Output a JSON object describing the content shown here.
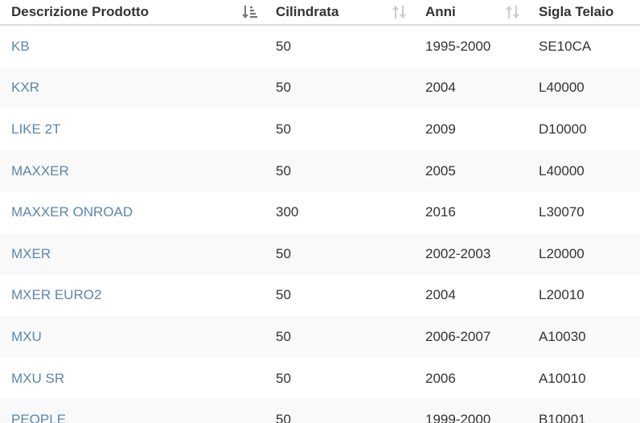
{
  "table": {
    "headers": [
      {
        "label": "Descrizione Prodotto",
        "sort": "active-desc"
      },
      {
        "label": "Cilindrata",
        "sort": "inactive"
      },
      {
        "label": "Anni",
        "sort": "inactive"
      },
      {
        "label": "Sigla Telaio",
        "sort": "none"
      }
    ],
    "rows": [
      {
        "desc": "KB",
        "cilindrata": "50",
        "anni": "1995-2000",
        "sigla": "SE10CA"
      },
      {
        "desc": "KXR",
        "cilindrata": "50",
        "anni": "2004",
        "sigla": "L40000"
      },
      {
        "desc": "LIKE 2T",
        "cilindrata": "50",
        "anni": "2009",
        "sigla": "D10000"
      },
      {
        "desc": "MAXXER",
        "cilindrata": "50",
        "anni": "2005",
        "sigla": "L40000"
      },
      {
        "desc": "MAXXER ONROAD",
        "cilindrata": "300",
        "anni": "2016",
        "sigla": "L30070"
      },
      {
        "desc": "MXER",
        "cilindrata": "50",
        "anni": "2002-2003",
        "sigla": "L20000"
      },
      {
        "desc": "MXER EURO2",
        "cilindrata": "50",
        "anni": "2004",
        "sigla": "L20010"
      },
      {
        "desc": "MXU",
        "cilindrata": "50",
        "anni": "2006-2007",
        "sigla": "A10030"
      },
      {
        "desc": "MXU SR",
        "cilindrata": "50",
        "anni": "2006",
        "sigla": "A10010"
      },
      {
        "desc": "PEOPLE",
        "cilindrata": "50",
        "anni": "1999-2000",
        "sigla": "B10001"
      }
    ]
  },
  "colors": {
    "link": "#5a87ad",
    "text": "#333333",
    "stripe": "#f9f9f9",
    "sort_active": "#777777",
    "sort_inactive": "#cccccc"
  }
}
